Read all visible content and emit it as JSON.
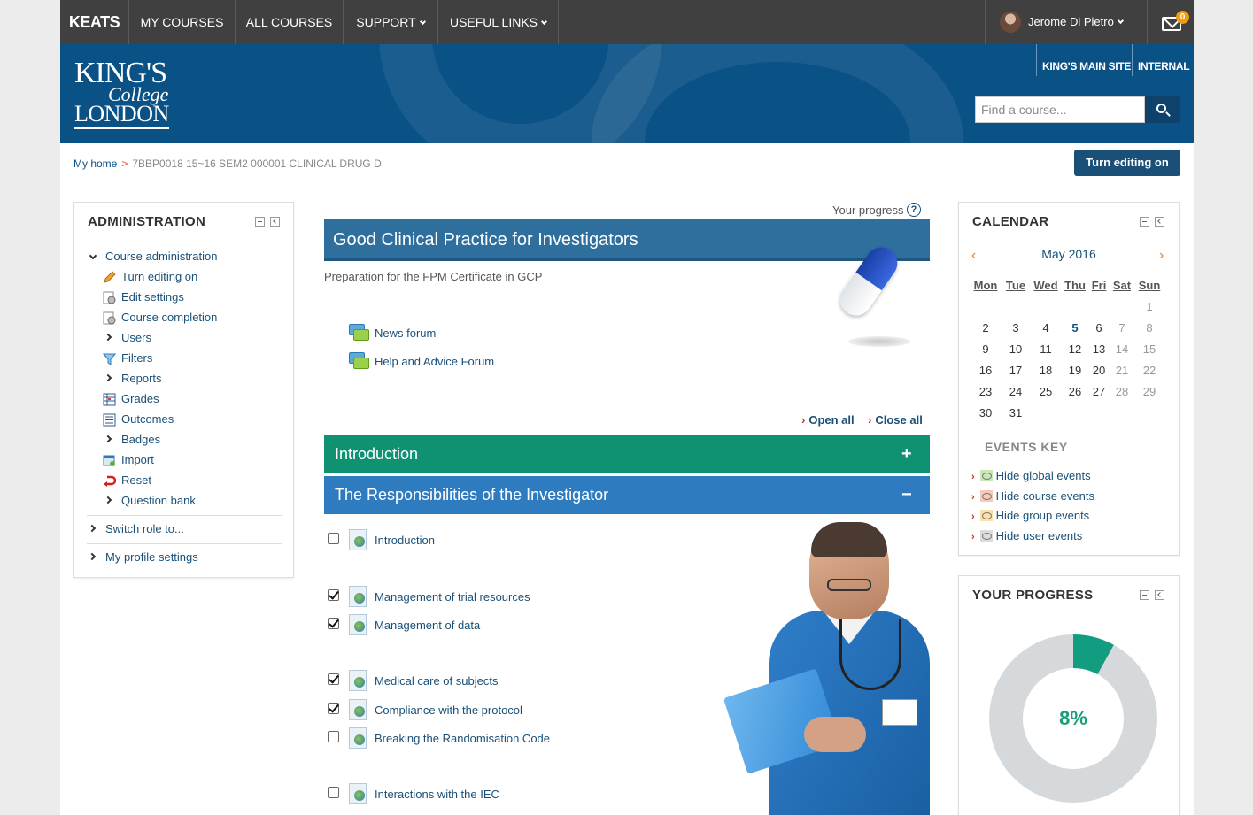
{
  "nav": {
    "brand": "KEATS",
    "my_courses": "MY COURSES",
    "all_courses": "ALL COURSES",
    "support": "SUPPORT",
    "useful_links": "USEFUL LINKS",
    "user_name": "Jerome Di Pietro",
    "message_count": "0"
  },
  "header": {
    "logo_line1": "KING'S",
    "logo_line2": "College",
    "logo_line3": "LONDON",
    "main_site": "KING'S MAIN SITE",
    "internal": "INTERNAL",
    "search_placeholder": "Find a course..."
  },
  "breadcrumb": {
    "home": "My home",
    "separator": ">",
    "current": "7BBP0018 15~16 SEM2 000001 CLINICAL DRUG D"
  },
  "edit_button": "Turn editing on",
  "admin": {
    "title": "ADMINISTRATION",
    "course_admin": "Course administration",
    "items": [
      "Turn editing on",
      "Edit settings",
      "Course completion",
      "Users",
      "Filters",
      "Reports",
      "Grades",
      "Outcomes",
      "Badges",
      "Import",
      "Reset",
      "Question bank"
    ],
    "switch_role": "Switch role to...",
    "profile_settings": "My profile settings"
  },
  "course": {
    "progress_label": "Your progress",
    "help": "?",
    "title": "Good Clinical Practice for Investigators",
    "subtitle": "Preparation for the FPM Certificate in GCP",
    "forums": [
      "News forum",
      "Help and Advice Forum"
    ],
    "open_all": "Open all",
    "close_all": "Close all",
    "sections": [
      {
        "title": "Introduction",
        "sign": "+",
        "color": "#0f9272"
      },
      {
        "title": "The Responsibilities of the Investigator",
        "sign": "−",
        "color": "#2f7bbf"
      }
    ],
    "activities": [
      {
        "label": "Introduction",
        "checked": false
      },
      {
        "label": "Management of trial resources",
        "checked": true
      },
      {
        "label": "Management of data",
        "checked": true
      },
      {
        "label": "Medical care of subjects",
        "checked": true
      },
      {
        "label": "Compliance with the protocol",
        "checked": true
      },
      {
        "label": "Breaking the Randomisation Code",
        "checked": false
      },
      {
        "label": "Interactions with the IEC",
        "checked": false
      }
    ]
  },
  "calendar": {
    "title": "CALENDAR",
    "month": "May 2016",
    "prev": "‹",
    "next": "›",
    "headers": [
      "Mon",
      "Tue",
      "Wed",
      "Thu",
      "Fri",
      "Sat",
      "Sun"
    ],
    "weeks": [
      [
        "",
        "",
        "",
        "",
        "",
        "",
        "1"
      ],
      [
        "2",
        "3",
        "4",
        "5",
        "6",
        "7",
        "8"
      ],
      [
        "9",
        "10",
        "11",
        "12",
        "13",
        "14",
        "15"
      ],
      [
        "16",
        "17",
        "18",
        "19",
        "20",
        "21",
        "22"
      ],
      [
        "23",
        "24",
        "25",
        "26",
        "27",
        "28",
        "29"
      ],
      [
        "30",
        "31",
        "",
        "",
        "",
        "",
        ""
      ]
    ],
    "today": "5",
    "events_key": "EVENTS KEY",
    "events": [
      {
        "label": "Hide global events",
        "color": "#c9e8b5"
      },
      {
        "label": "Hide course events",
        "color": "#f7c9b8"
      },
      {
        "label": "Hide group events",
        "color": "#fbe0a8"
      },
      {
        "label": "Hide user events",
        "color": "#dcdcdc"
      }
    ]
  },
  "your_progress": {
    "title": "YOUR PROGRESS",
    "percent_label": "8%",
    "percent": 8,
    "fill_color": "#139d80",
    "track_color": "#d6d9db"
  }
}
